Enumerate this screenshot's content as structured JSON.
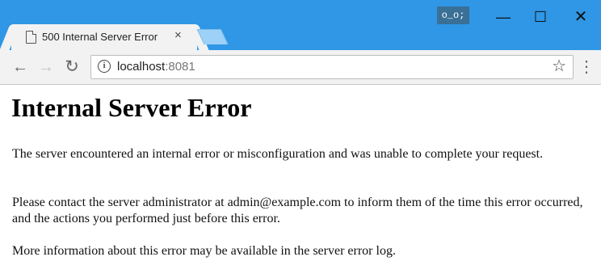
{
  "browser": {
    "tab_title": "500 Internal Server Error",
    "tab_close": "×",
    "profile_badge": "o_o;",
    "window_controls": {
      "minimize": "—",
      "maximize": "☐",
      "close": "✕"
    },
    "nav": {
      "back": "←",
      "forward": "→",
      "reload": "↻"
    },
    "address": {
      "host": "localhost",
      "port": ":8081"
    },
    "bookmark_icon": "☆",
    "menu_icon": "⋮"
  },
  "page": {
    "heading": "Internal Server Error",
    "paragraphs": [
      "The server encountered an internal error or misconfiguration and was unable to complete your request.",
      "Please contact the server administrator at admin@example.com to inform them of the time this error occurred, and the actions you performed just before this error.",
      "More information about this error may be available in the server error log."
    ]
  },
  "colors": {
    "titlebar": "#2f97e6",
    "toolbar": "#f2f2f2",
    "page_background": "#ffffff"
  },
  "icons": {
    "tab_favicon": "document-icon",
    "info": "info-icon",
    "bookmark": "star-icon",
    "menu": "more-vertical-icon"
  }
}
